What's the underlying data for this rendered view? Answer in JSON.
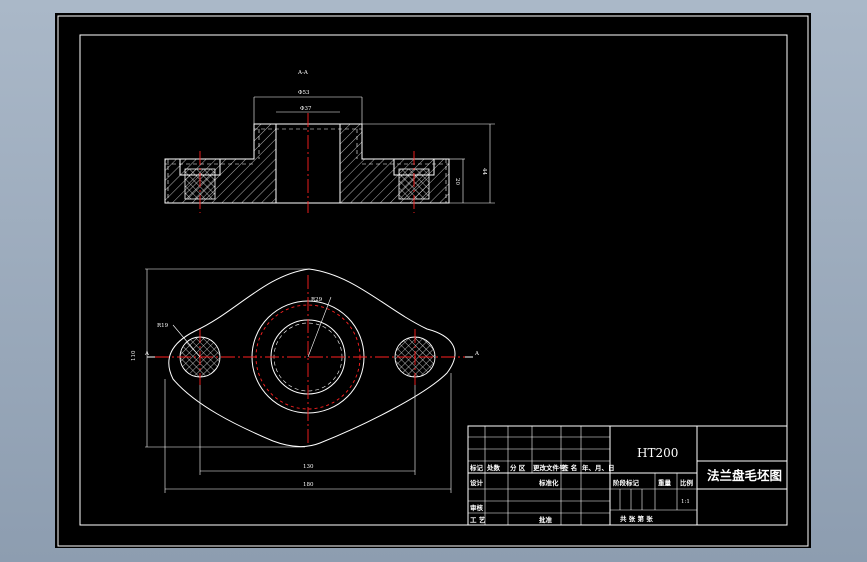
{
  "labels": {
    "section": "A-A",
    "dim_top_outer": "Φ53",
    "dim_top_inner": "Φ37",
    "dim_height_total": "44",
    "dim_height_flange": "20",
    "dim_hole_radius": "R19",
    "dim_boss_radius": "R29",
    "dim_width_holes": "130",
    "dim_width_total": "180",
    "dim_height_plan": "110",
    "section_marker": "A"
  },
  "title_block": {
    "material": "HT200",
    "drawing_name": "法兰盘毛坯图",
    "row_labels": [
      "标记",
      "处数",
      "分 区",
      "更改文件号",
      "签 名",
      "年、月、日"
    ],
    "design": "设计",
    "standardize": "标准化",
    "review": "审核",
    "process": "工 艺",
    "approve": "批准",
    "stage_mark": "阶段标记",
    "weight": "重量",
    "scale": "比例",
    "scale_value": "1:1",
    "sheets": "共  张  第  张"
  }
}
